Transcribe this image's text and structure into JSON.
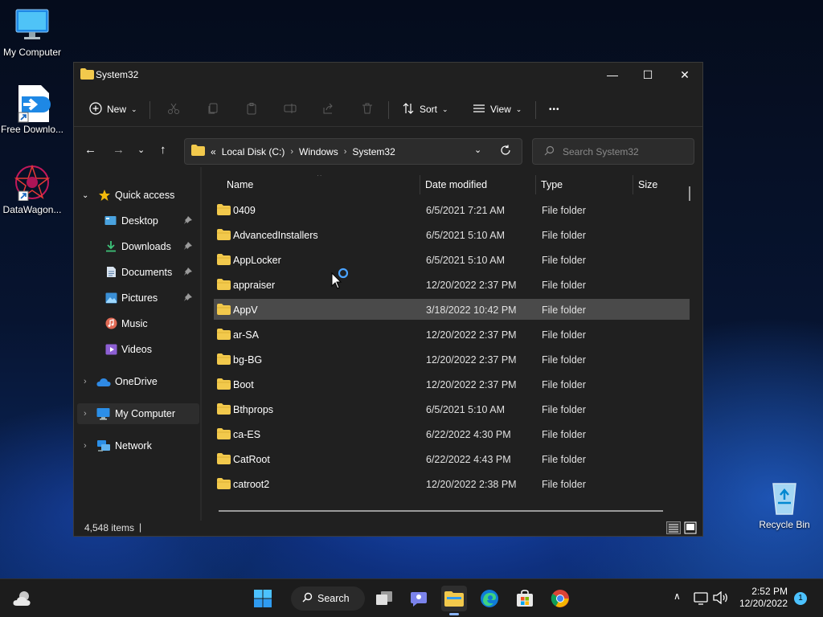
{
  "desktop": {
    "icons": [
      {
        "label": "My Computer"
      },
      {
        "label": "Free Downlo..."
      },
      {
        "label": "DataWagon..."
      },
      {
        "label": "Recycle Bin"
      }
    ]
  },
  "window": {
    "title": "System32",
    "controls": {
      "minimize": "—",
      "maximize": "☐",
      "close": "✕"
    },
    "commandbar": {
      "new_label": "New",
      "sort_label": "Sort",
      "view_label": "View",
      "more_label": "•••"
    },
    "address": {
      "overflow": "«",
      "crumbs": [
        "Local Disk (C:)",
        "Windows",
        "System32"
      ]
    },
    "search": {
      "placeholder": "Search System32"
    },
    "nav": {
      "quick_access": "Quick access",
      "items": [
        {
          "label": "Desktop",
          "pinned": true
        },
        {
          "label": "Downloads",
          "pinned": true
        },
        {
          "label": "Documents",
          "pinned": true
        },
        {
          "label": "Pictures",
          "pinned": true
        },
        {
          "label": "Music",
          "pinned": false
        },
        {
          "label": "Videos",
          "pinned": false
        }
      ],
      "onedrive": "OneDrive",
      "my_computer": "My Computer",
      "network": "Network"
    },
    "columns": {
      "name": "Name",
      "date": "Date modified",
      "type": "Type",
      "size": "Size"
    },
    "files": [
      {
        "name": "0409",
        "date": "6/5/2021 7:21 AM",
        "type": "File folder"
      },
      {
        "name": "AdvancedInstallers",
        "date": "6/5/2021 5:10 AM",
        "type": "File folder"
      },
      {
        "name": "AppLocker",
        "date": "6/5/2021 5:10 AM",
        "type": "File folder"
      },
      {
        "name": "appraiser",
        "date": "12/20/2022 2:37 PM",
        "type": "File folder"
      },
      {
        "name": "AppV",
        "date": "3/18/2022 10:42 PM",
        "type": "File folder"
      },
      {
        "name": "ar-SA",
        "date": "12/20/2022 2:37 PM",
        "type": "File folder"
      },
      {
        "name": "bg-BG",
        "date": "12/20/2022 2:37 PM",
        "type": "File folder"
      },
      {
        "name": "Boot",
        "date": "12/20/2022 2:37 PM",
        "type": "File folder"
      },
      {
        "name": "Bthprops",
        "date": "6/5/2021 5:10 AM",
        "type": "File folder"
      },
      {
        "name": "ca-ES",
        "date": "6/22/2022 4:30 PM",
        "type": "File folder"
      },
      {
        "name": "CatRoot",
        "date": "6/22/2022 4:43 PM",
        "type": "File folder"
      },
      {
        "name": "catroot2",
        "date": "12/20/2022 2:38 PM",
        "type": "File folder"
      }
    ],
    "status": {
      "items": "4,548 items",
      "cursor": "|"
    }
  },
  "taskbar": {
    "search_label": "Search",
    "time": "2:52 PM",
    "date": "12/20/2022",
    "notifications": "1"
  },
  "colors": {
    "window_bg": "#202020",
    "selected_row": "#4a4a4a",
    "folder_yellow": "#f2c94c",
    "accent_blue": "#4cc2ff"
  }
}
